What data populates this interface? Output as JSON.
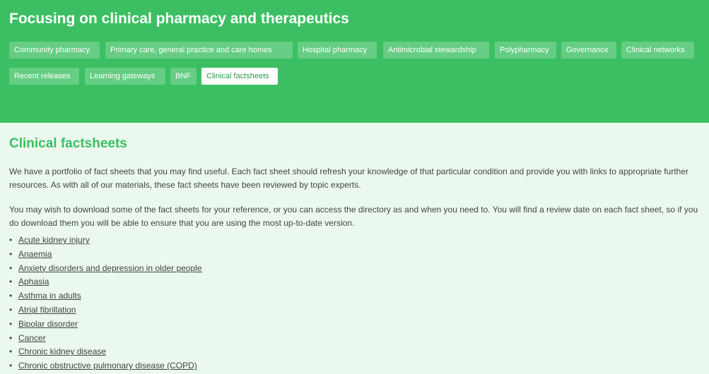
{
  "header": {
    "title": "Focusing on clinical pharmacy and therapeutics"
  },
  "nav": {
    "chips": [
      {
        "label": "Community pharmacy",
        "active": false
      },
      {
        "label": "Primary care, general practice and care homes",
        "active": false
      },
      {
        "label": "Hospital pharmacy",
        "active": false
      },
      {
        "label": "Antimicrobial stewardship",
        "active": false
      },
      {
        "label": "Polypharmacy",
        "active": false
      },
      {
        "label": "Governance",
        "active": false
      },
      {
        "label": "Clinical networks",
        "active": false
      },
      {
        "label": "Recent releases",
        "active": false
      },
      {
        "label": "Learning gateways",
        "active": false
      },
      {
        "label": "BNF",
        "active": false
      },
      {
        "label": "Clinical factsheets",
        "active": true
      }
    ]
  },
  "main": {
    "title": "Clinical factsheets",
    "paragraphs": [
      "We have a portfolio of fact sheets that you may find useful. Each fact sheet should refresh your knowledge of that particular condition and provide you with links to appropriate further resources. As with all of our materials, these fact sheets have been reviewed by topic experts.",
      "You may wish to download some of the fact sheets for your reference, or you can access the directory as and when you need to. You will find a review date on each fact sheet, so if you do download them you will be able to ensure that you are using the most up-to-date version."
    ],
    "bullet_glyph": "•",
    "factsheets": [
      "Acute kidney injury",
      "Anaemia",
      "Anxiety disorders and depression in older people",
      "Aphasia",
      "Asthma in adults",
      "Atrial fibrillation",
      "Bipolar disorder",
      "Cancer",
      "Chronic kidney disease ",
      "Chronic obstructive pulmonary disease (COPD)"
    ]
  },
  "colors": {
    "brand_green": "#3cbf62",
    "page_background": "#eaf8ee",
    "body_text": "#444444"
  }
}
